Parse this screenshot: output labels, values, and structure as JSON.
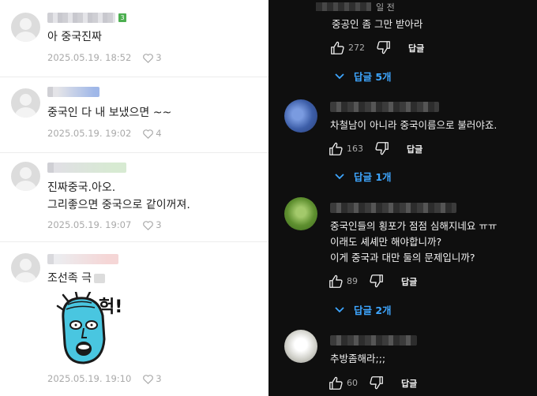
{
  "left_panel": {
    "comments": [
      {
        "text_lines": [
          "아 중국진짜"
        ],
        "date": "2025.05.19. 18:52",
        "likes": "3",
        "badge": "3"
      },
      {
        "text_lines": [
          "중국인 다 내 보냈으면 ~~"
        ],
        "date": "2025.05.19. 19:02",
        "likes": "4"
      },
      {
        "text_lines": [
          "진짜중국.아오.",
          "그리좋으면 중국으로 같이꺼져."
        ],
        "date": "2025.05.19. 19:07",
        "likes": "3"
      },
      {
        "text_lines": [
          "조선족 극"
        ],
        "date": "2025.05.19. 19:10",
        "likes": "3",
        "sticker_text": "헉!"
      }
    ]
  },
  "right_panel": {
    "top_fragment": {
      "time": "일 전",
      "text": "중공인 좀 그만 받아라",
      "likes": "272",
      "reply_label": "답글",
      "replies_label": "답글 5개"
    },
    "comments": [
      {
        "text_lines": [
          "차철남이 아니라 중국이름으로 불러야죠."
        ],
        "likes": "163",
        "reply_label": "답글",
        "replies_label": "답글 1개",
        "avatar_color": "#4a6fb5"
      },
      {
        "text_lines": [
          "중국인들의 횡포가 점점 심해지네요 ㅠㅠ",
          "이래도 셰셰만 해야합니까?",
          "이게 중국과 대만 둘의 문제입니까?"
        ],
        "likes": "89",
        "reply_label": "답글",
        "replies_label": "답글 2개",
        "avatar_color": "#6a9a3a"
      },
      {
        "text_lines": [
          "추방좀해라;;;"
        ],
        "likes": "60",
        "reply_label": "답글",
        "avatar_color": "#d8d8d0"
      }
    ]
  }
}
